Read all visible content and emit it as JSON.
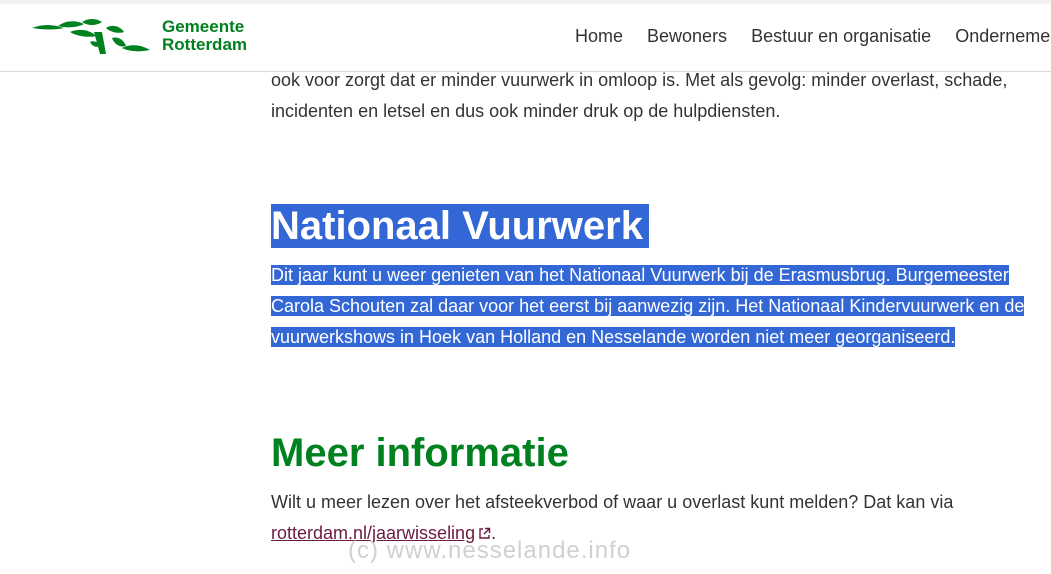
{
  "header": {
    "logo_line1": "Gemeente",
    "logo_line2": "Rotterdam",
    "nav": [
      "Home",
      "Bewoners",
      "Bestuur en organisatie",
      "Ondernemen"
    ]
  },
  "article": {
    "intro_line1": "ook voor zorgt dat er minder vuurwerk in omloop is. Met als gevolg: minder overlast, schade,",
    "intro_line2": "incidenten en letsel en dus ook minder druk op de hulpdiensten.",
    "national_heading": "Nationaal Vuurwerk",
    "national_line1": "Dit jaar kunt u weer genieten van het Nationaal Vuurwerk bij de Erasmusbrug. Burgemeester",
    "national_line2": "Carola Schouten zal daar voor het eerst bij aanwezig zijn. Het Nationaal Kindervuurwerk en de",
    "national_line3": "vuurwerkshows in Hoek van Holland en Nesselande worden niet meer georganiseerd.",
    "meer_heading": "Meer informatie",
    "meer_line1": "Wilt u meer lezen over het afsteekverbod of waar u overlast kunt melden? Dat kan via",
    "meer_link": "rotterdam.nl/jaarwisseling",
    "meer_end": "."
  },
  "watermark": "(c)  www.nesselande.info",
  "colors": {
    "brand_green": "#00811f",
    "selection": "#3367d6",
    "link": "#6b1b3e"
  }
}
